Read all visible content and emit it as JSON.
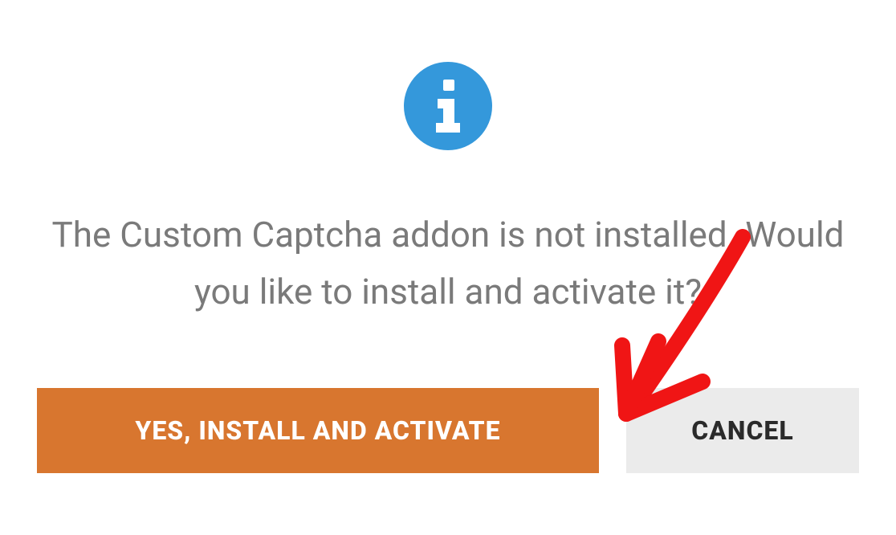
{
  "dialog": {
    "message": "The Custom Captcha addon is not installed. Would you like to install and activate it?",
    "confirm_label": "Yes, Install and Activate",
    "cancel_label": "Cancel",
    "icon_color": "#3498db",
    "confirm_bg": "#d8762f",
    "cancel_bg": "#ebebeb"
  }
}
